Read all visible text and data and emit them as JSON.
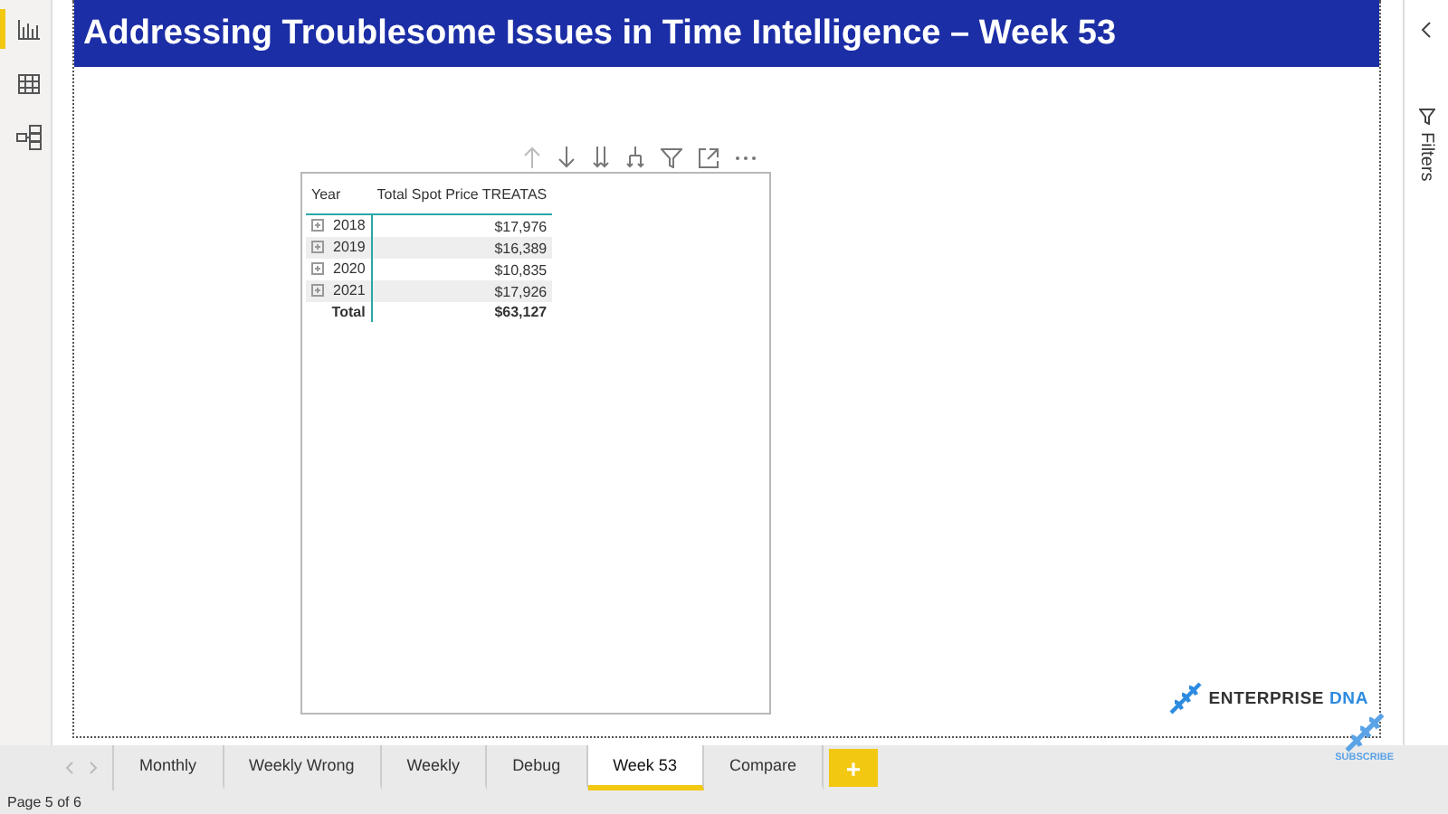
{
  "report_title": "Addressing Troublesome Issues in Time Intelligence – Week 53",
  "sidebar": {
    "items": [
      {
        "kind": "report",
        "selected": true
      },
      {
        "kind": "data",
        "selected": false
      },
      {
        "kind": "model",
        "selected": false
      }
    ]
  },
  "filters_pane": {
    "label": "Filters"
  },
  "table": {
    "columns": [
      "Year",
      "Total Spot Price TREATAS"
    ],
    "rows": [
      {
        "year": "2018",
        "value": "$17,976"
      },
      {
        "year": "2019",
        "value": "$16,389"
      },
      {
        "year": "2020",
        "value": "$10,835"
      },
      {
        "year": "2021",
        "value": "$17,926"
      }
    ],
    "total": {
      "label": "Total",
      "value": "$63,127"
    }
  },
  "logo": {
    "word_1": "ENTERPRISE",
    "word_2": "DNA",
    "subscribe": "SUBSCRIBE"
  },
  "page_tabs": [
    {
      "label": "Monthly",
      "selected": false
    },
    {
      "label": "Weekly Wrong",
      "selected": false
    },
    {
      "label": "Weekly",
      "selected": false
    },
    {
      "label": "Debug",
      "selected": false
    },
    {
      "label": "Week 53",
      "selected": true
    },
    {
      "label": "Compare",
      "selected": false
    }
  ],
  "add_page": "+",
  "status_bar": "Page 5 of 6"
}
